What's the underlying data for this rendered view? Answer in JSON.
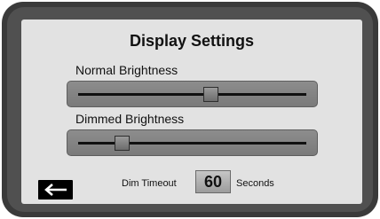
{
  "screen": {
    "title": "Display Settings"
  },
  "sliders": [
    {
      "label": "Normal Brightness",
      "value_fraction": 0.58
    },
    {
      "label": "Dimmed Brightness",
      "value_fraction": 0.19
    }
  ],
  "dim_timeout": {
    "label": "Dim Timeout",
    "value": "60",
    "unit": "Seconds"
  },
  "icons": {
    "back": "left-arrow-icon"
  }
}
